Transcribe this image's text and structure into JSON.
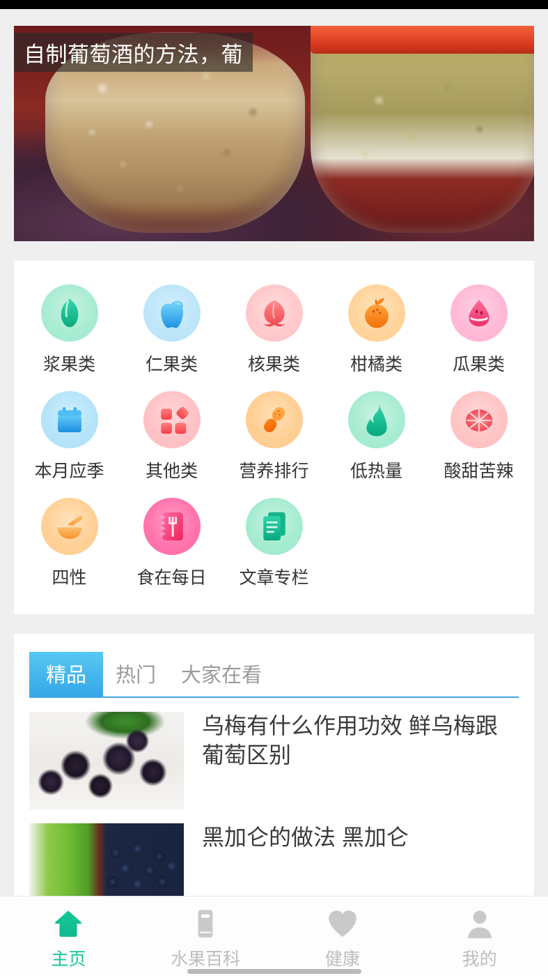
{
  "app": {
    "accent_teal": "#15c79a",
    "accent_blue": "#35a7e8",
    "page_bg": "#efefef",
    "card_bg": "#ffffff"
  },
  "banner": {
    "title": "自制葡萄酒的方法，葡",
    "image_alt": "两罐自制葡萄酒发酵中"
  },
  "categories": {
    "items": [
      {
        "label": "浆果类",
        "icon": "berry-icon",
        "circle": "bg-mint",
        "glyph": "berry"
      },
      {
        "label": "仁果类",
        "icon": "apple-icon",
        "circle": "bg-sky",
        "glyph": "apple"
      },
      {
        "label": "核果类",
        "icon": "peach-icon",
        "circle": "bg-rose",
        "glyph": "peach"
      },
      {
        "label": "柑橘类",
        "icon": "orange-icon",
        "circle": "bg-peach",
        "glyph": "orange"
      },
      {
        "label": "瓜果类",
        "icon": "watermelon-icon",
        "circle": "bg-pinkm",
        "glyph": "melon"
      },
      {
        "label": "本月应季",
        "icon": "calendar-icon",
        "circle": "bg-sky2",
        "glyph": "calendar"
      },
      {
        "label": "其他类",
        "icon": "grid-icon",
        "circle": "bg-rose2",
        "glyph": "grid"
      },
      {
        "label": "营养排行",
        "icon": "capsule-icon",
        "circle": "bg-peach2",
        "glyph": "capsule"
      },
      {
        "label": "低热量",
        "icon": "flame-icon",
        "circle": "bg-mint2",
        "glyph": "flame"
      },
      {
        "label": "酸甜苦辣",
        "icon": "grapefruit-icon",
        "circle": "bg-rose3",
        "glyph": "grapefruit"
      },
      {
        "label": "四性",
        "icon": "bowl-spoon-icon",
        "circle": "bg-peach3",
        "glyph": "bowl"
      },
      {
        "label": "食在每日",
        "icon": "recipe-book-icon",
        "circle": "bg-pink3",
        "glyph": "book"
      },
      {
        "label": "文章专栏",
        "icon": "document-icon",
        "circle": "bg-mint3",
        "glyph": "doc"
      }
    ]
  },
  "feed": {
    "tabs": [
      {
        "label": "精品",
        "active": true
      },
      {
        "label": "热门",
        "active": false
      },
      {
        "label": "大家在看",
        "active": false
      }
    ],
    "articles": [
      {
        "title": "乌梅有什么作用功效 鲜乌梅跟葡萄区别",
        "thumb": "thumb-umei"
      },
      {
        "title": "黑加仑的做法 黑加仑",
        "thumb": "thumb-currant"
      }
    ]
  },
  "bottom_nav": {
    "items": [
      {
        "label": "主页",
        "icon": "home-icon",
        "active": true
      },
      {
        "label": "水果百科",
        "icon": "book-icon",
        "active": false
      },
      {
        "label": "健康",
        "icon": "heart-icon",
        "active": false
      },
      {
        "label": "我的",
        "icon": "person-icon",
        "active": false
      }
    ]
  }
}
